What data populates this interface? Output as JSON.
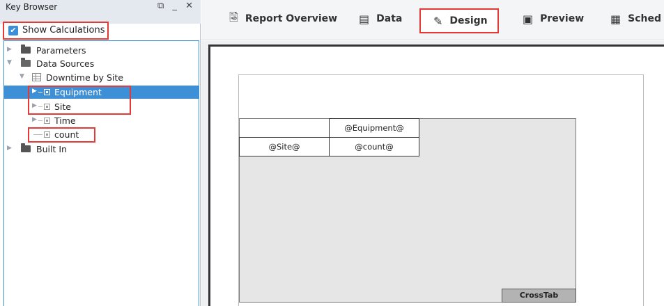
{
  "key_browser": {
    "title": "Key Browser",
    "controls": {
      "restore": "⧉",
      "minimize": "_",
      "close": "✕"
    },
    "show_calculations": {
      "label": "Show Calculations",
      "checked": true
    },
    "tree": {
      "parameters": "Parameters",
      "data_sources": "Data Sources",
      "downtime_by_site": "Downtime by Site",
      "equipment": "Equipment",
      "site": "Site",
      "time": "Time",
      "count": "count",
      "built_in": "Built In"
    }
  },
  "tabs": {
    "report_overview": "Report Overview",
    "data": "Data",
    "design": "Design",
    "preview": "Preview",
    "schedule": "Sched"
  },
  "icons": {
    "report_overview": "magnifier-document-icon",
    "data": "database-icon",
    "design": "pencil-document-icon",
    "preview": "image-icon",
    "schedule": "calendar-icon"
  },
  "crosstab": {
    "column_header": "@Equipment@",
    "row_header": "@Site@",
    "value": "@count@",
    "label": "CrossTab"
  },
  "colors": {
    "selection": "#3d8fd6",
    "highlight_box": "#e53935",
    "checkbox": "#3b8fd9"
  }
}
